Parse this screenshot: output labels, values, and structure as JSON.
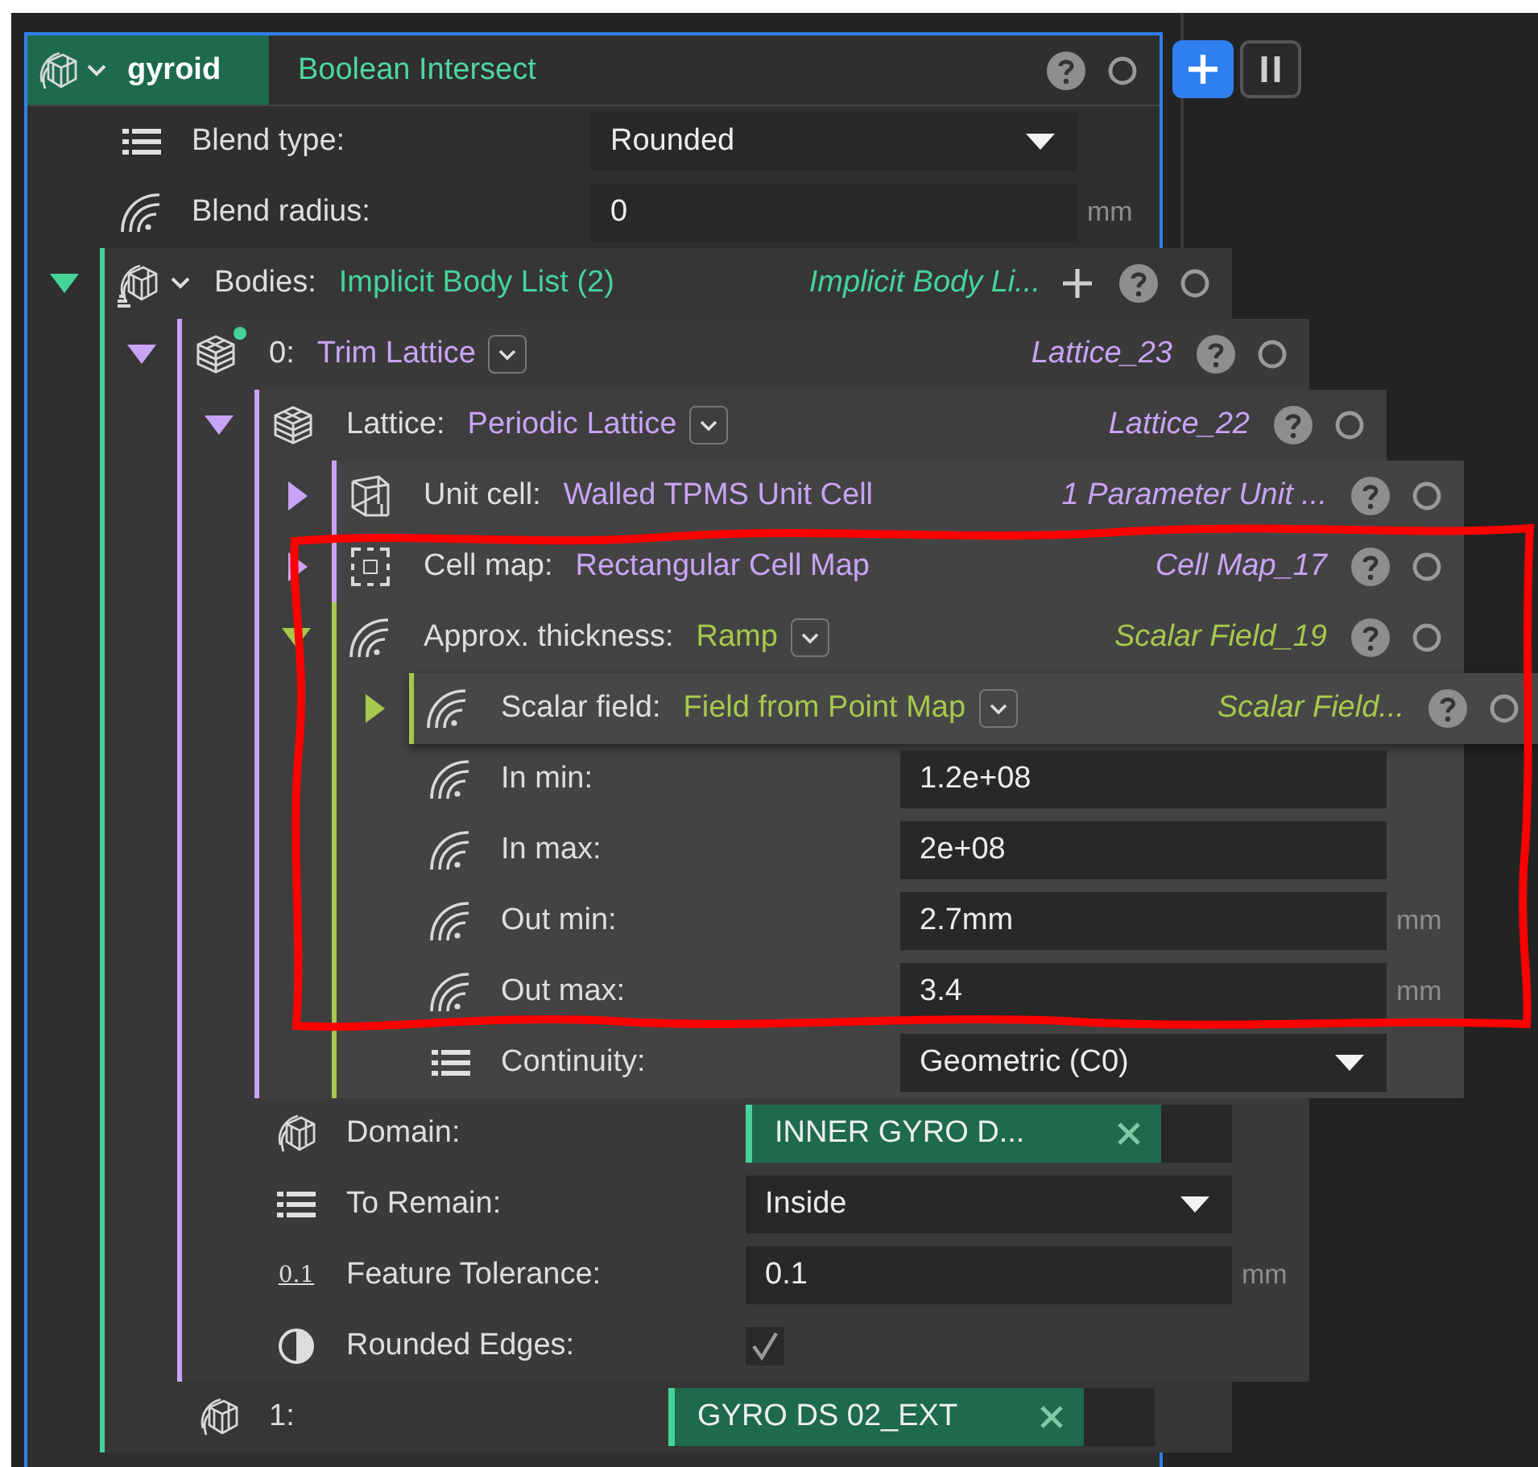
{
  "side_buttons": [
    {
      "kind": "add",
      "selected": true
    },
    {
      "kind": "pause",
      "selected": false
    }
  ],
  "root": {
    "name": "gyroid",
    "type": "Boolean Intersect",
    "selected": true,
    "children": [
      {
        "kind": "dropdown",
        "label": "Blend type:",
        "value": "Rounded"
      },
      {
        "kind": "number",
        "label": "Blend radius:",
        "value": "0",
        "unit": "mm"
      },
      {
        "kind": "body-list",
        "label": "Bodies:",
        "type": "Implicit Body List (2)",
        "instance": "Implicit Body Li...",
        "color": "#45d39a",
        "expanded": true,
        "type_menu": false,
        "add_button": true,
        "badge": false,
        "children": [
          {
            "kind": "lattice",
            "label": "0:",
            "type": "Trim Lattice",
            "instance": "Lattice_23",
            "color": "#c9a3f5",
            "expanded": true,
            "type_menu": true,
            "add_button": false,
            "badge": true,
            "children": [
              {
                "kind": "lattice",
                "label": "Lattice:",
                "type": "Periodic Lattice",
                "instance": "Lattice_22",
                "color": "#c9a3f5",
                "expanded": true,
                "type_menu": true,
                "add_button": false,
                "badge": false,
                "children": [
                  {
                    "kind": "unit-cell",
                    "label": "Unit cell:",
                    "type": "Walled TPMS Unit Cell",
                    "instance": "1 Parameter Unit ...",
                    "color": "#c9a3f5",
                    "expanded": false,
                    "type_menu": false,
                    "add_button": false,
                    "badge": false
                  },
                  {
                    "kind": "cell-map",
                    "label": "Cell map:",
                    "type": "Rectangular Cell Map",
                    "instance": "Cell Map_17",
                    "color": "#c9a3f5",
                    "expanded": false,
                    "type_menu": false,
                    "add_button": false,
                    "badge": false
                  },
                  {
                    "kind": "scalar",
                    "label": "Approx. thickness:",
                    "type": "Ramp",
                    "instance": "Scalar Field_19",
                    "color": "#a6c84c",
                    "expanded": true,
                    "type_menu": true,
                    "add_button": false,
                    "badge": false,
                    "children": [
                      {
                        "kind": "scalar",
                        "label": "Scalar field:",
                        "type": "Field from Point Map",
                        "instance": "Scalar Field...",
                        "color": "#a6c84c",
                        "expanded": false,
                        "type_menu": true,
                        "add_button": false,
                        "badge": false
                      },
                      {
                        "kind": "number",
                        "label": "In min:",
                        "value": "1.2e+08"
                      },
                      {
                        "kind": "number",
                        "label": "In max:",
                        "value": "2e+08"
                      },
                      {
                        "kind": "number",
                        "label": "Out min:",
                        "value": "2.7mm",
                        "unit": "mm"
                      },
                      {
                        "kind": "number",
                        "label": "Out max:",
                        "value": "3.4",
                        "unit": "mm"
                      },
                      {
                        "kind": "dropdown",
                        "label": "Continuity:",
                        "value": "Geometric (C0)"
                      }
                    ]
                  }
                ]
              },
              {
                "kind": "body",
                "label": "Domain:",
                "value": "INNER GYRO D..."
              },
              {
                "kind": "dropdown",
                "label": "To Remain:",
                "value": "Inside"
              },
              {
                "kind": "tolerance",
                "icon_text": "0.1",
                "label": "Feature Tolerance:",
                "value": "0.1",
                "unit": "mm"
              },
              {
                "kind": "toggle",
                "label": "Rounded Edges:",
                "checked": true
              }
            ]
          },
          {
            "kind": "body",
            "label": "1:",
            "value": "GYRO DS 02_EXT"
          }
        ]
      }
    ]
  }
}
